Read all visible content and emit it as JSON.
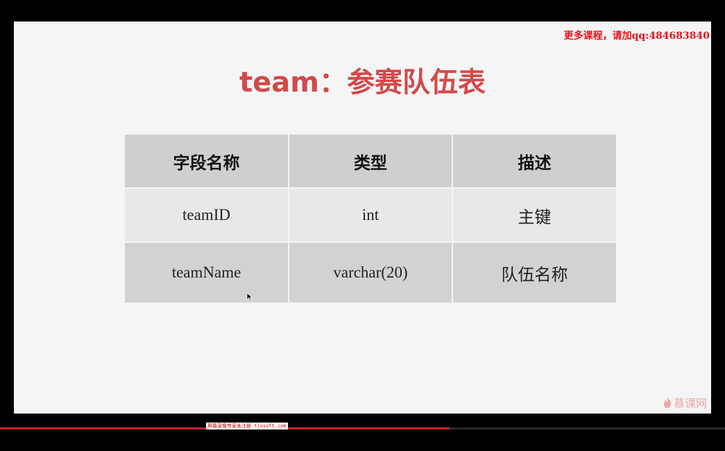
{
  "watermark": "更多课程，请加qq:484683840",
  "slide": {
    "title": "team：参赛队伍表",
    "table": {
      "headers": [
        "字段名称",
        "类型",
        "描述"
      ],
      "rows": [
        [
          "teamID",
          "int",
          "主键"
        ],
        [
          "teamName",
          "varchar(20)",
          "队伍名称"
        ]
      ]
    }
  },
  "logo": {
    "icon": "flame-icon",
    "text": "慕课网"
  },
  "player": {
    "progress": 0.62,
    "recorder_banner": "屏幕录像专家未注册 tlxsoft.com"
  },
  "colors": {
    "title": "#d24a4a",
    "watermark": "#e8141a",
    "header_bg": "#cfcfcf",
    "progress": "#c62828"
  }
}
